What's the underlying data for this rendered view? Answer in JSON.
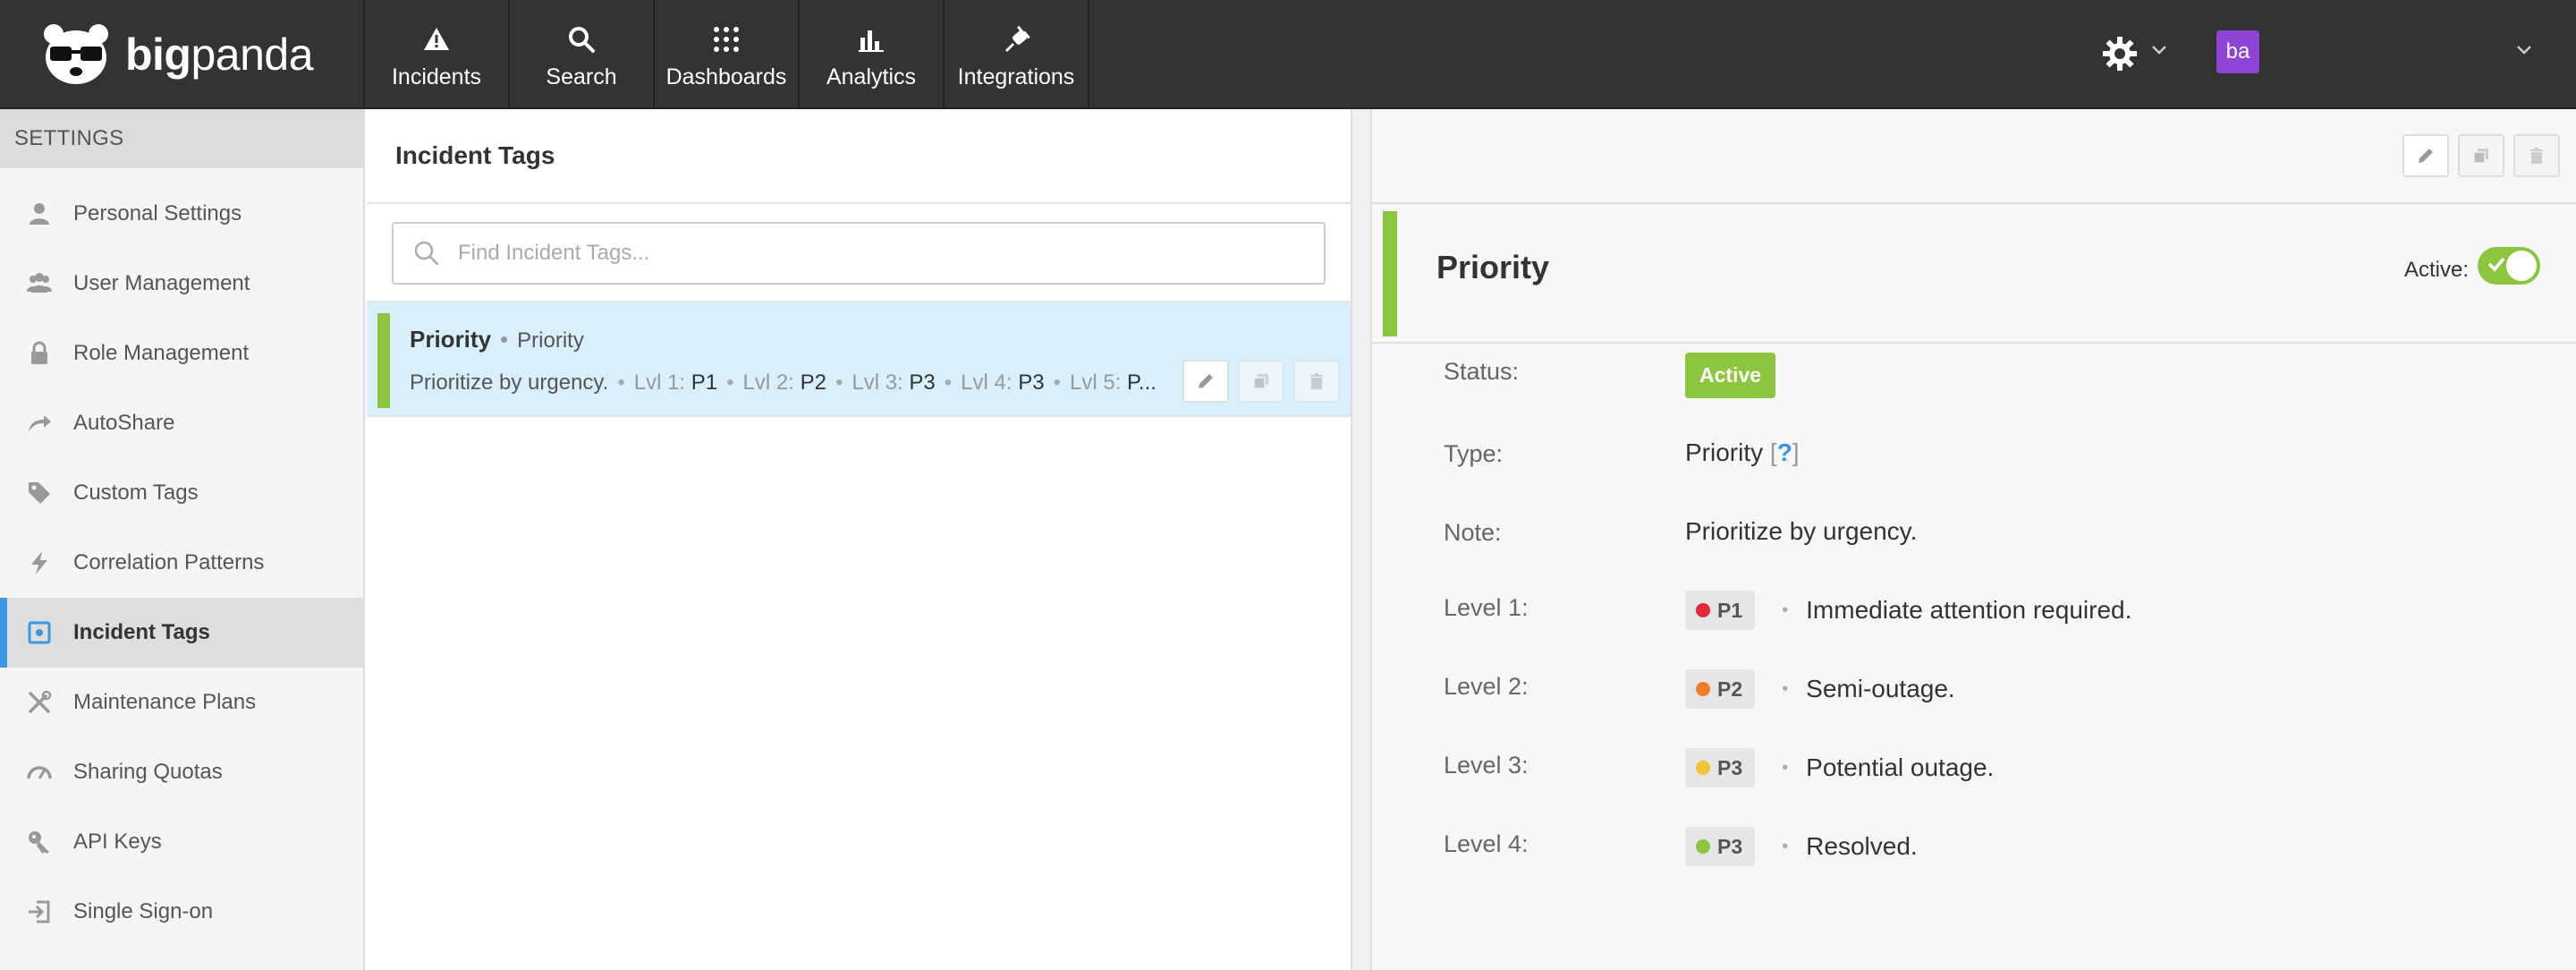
{
  "brand": {
    "bold": "big",
    "light": "panda"
  },
  "nav": [
    {
      "label": "Incidents",
      "icon": "warning-icon"
    },
    {
      "label": "Search",
      "icon": "search-icon"
    },
    {
      "label": "Dashboards",
      "icon": "grid-icon"
    },
    {
      "label": "Analytics",
      "icon": "bar-chart-icon"
    },
    {
      "label": "Integrations",
      "icon": "plug-icon"
    }
  ],
  "user": {
    "initials": "ba",
    "avatar_color": "#8e44d6"
  },
  "sidebar": {
    "header": "SETTINGS",
    "items": [
      {
        "label": "Personal Settings",
        "icon": "person-icon"
      },
      {
        "label": "User Management",
        "icon": "users-icon"
      },
      {
        "label": "Role Management",
        "icon": "lock-icon"
      },
      {
        "label": "AutoShare",
        "icon": "share-arrow-icon"
      },
      {
        "label": "Custom Tags",
        "icon": "tag-icon"
      },
      {
        "label": "Correlation Patterns",
        "icon": "bolt-icon"
      },
      {
        "label": "Incident Tags",
        "icon": "incident-tag-icon",
        "active": true
      },
      {
        "label": "Maintenance Plans",
        "icon": "tools-icon"
      },
      {
        "label": "Sharing Quotas",
        "icon": "gauge-icon"
      },
      {
        "label": "API Keys",
        "icon": "key-icon"
      },
      {
        "label": "Single Sign-on",
        "icon": "sign-in-icon"
      }
    ]
  },
  "list_panel": {
    "title": "Incident Tags",
    "search_placeholder": "Find Incident Tags...",
    "rows": [
      {
        "name": "Priority",
        "type": "Priority",
        "note": "Prioritize by urgency.",
        "levels": [
          {
            "label": "Lvl 1:",
            "value": "P1"
          },
          {
            "label": "Lvl 2:",
            "value": "P2"
          },
          {
            "label": "Lvl 3:",
            "value": "P3"
          },
          {
            "label": "Lvl 4:",
            "value": "P3"
          },
          {
            "label": "Lvl 5:",
            "value": "P..."
          }
        ]
      }
    ]
  },
  "detail": {
    "title": "Priority",
    "active_label": "Active:",
    "active": true,
    "fields": {
      "status_label": "Status:",
      "status_value": "Active",
      "type_label": "Type:",
      "type_value": "Priority",
      "type_help": "?",
      "note_label": "Note:",
      "note_value": "Prioritize by urgency."
    },
    "levels": [
      {
        "label": "Level 1:",
        "tag": "P1",
        "color": "#e0283a",
        "desc": "Immediate attention required."
      },
      {
        "label": "Level 2:",
        "tag": "P2",
        "color": "#f07c2a",
        "desc": "Semi-outage."
      },
      {
        "label": "Level 3:",
        "tag": "P3",
        "color": "#f2c334",
        "desc": "Potential outage."
      },
      {
        "label": "Level 4:",
        "tag": "P3",
        "color": "#8cc63f",
        "desc": "Resolved."
      }
    ]
  },
  "colors": {
    "accent": "#3b97e3",
    "green": "#8cc63f",
    "topbar": "#333333"
  }
}
